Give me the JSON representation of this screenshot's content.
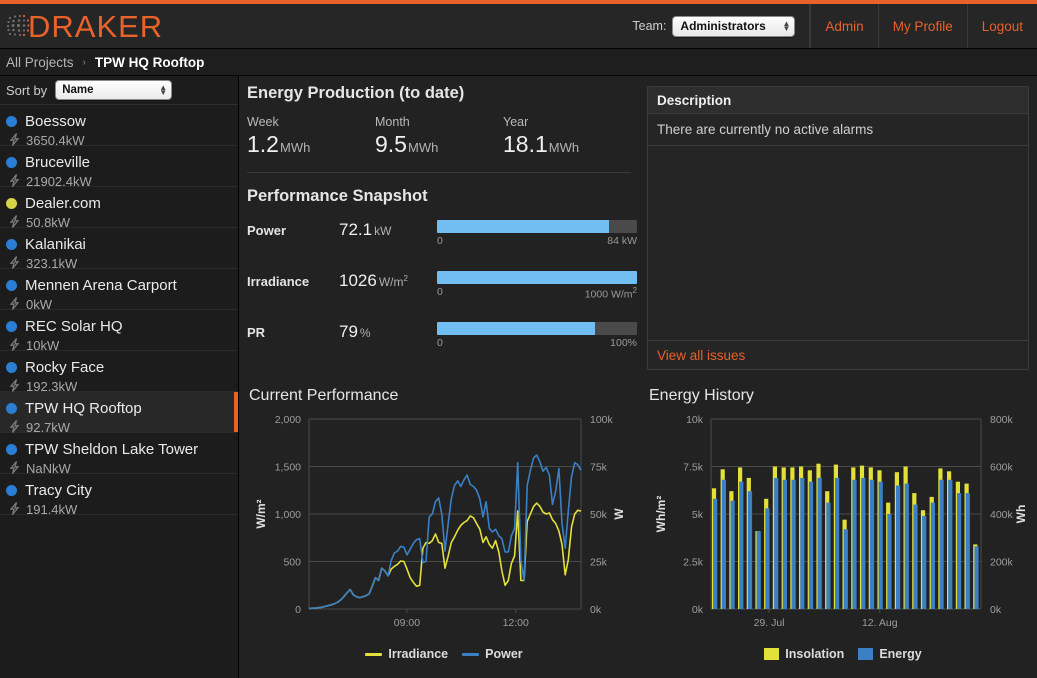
{
  "header": {
    "logo_text": "DRAKER",
    "logo_icon": "dot-matrix-icon",
    "team_label": "Team:",
    "team_value": "Administrators",
    "team_options": [
      "Administrators"
    ],
    "links": [
      {
        "label": "Admin"
      },
      {
        "label": "My Profile"
      },
      {
        "label": "Logout"
      }
    ],
    "accent_color": "#e8622a"
  },
  "breadcrumb": {
    "root": "All Projects",
    "separator": "›",
    "current": "TPW HQ Rooftop"
  },
  "sidebar": {
    "sort_label": "Sort by",
    "sort_value": "Name",
    "sort_options": [
      "Name"
    ],
    "status_colors": {
      "ok": "#2a7fd4",
      "warn": "#d8d44a"
    },
    "sites": [
      {
        "name": "Boessow",
        "power": "3650.4kW",
        "status": "ok",
        "selected": false
      },
      {
        "name": "Bruceville",
        "power": "21902.4kW",
        "status": "ok",
        "selected": false
      },
      {
        "name": "Dealer.com",
        "power": "50.8kW",
        "status": "warn",
        "selected": false
      },
      {
        "name": "Kalanikai",
        "power": "323.1kW",
        "status": "ok",
        "selected": false
      },
      {
        "name": "Mennen Arena Carport",
        "power": "0kW",
        "status": "ok",
        "selected": false
      },
      {
        "name": "REC Solar HQ",
        "power": "10kW",
        "status": "ok",
        "selected": false
      },
      {
        "name": "Rocky Face",
        "power": "192.3kW",
        "status": "ok",
        "selected": false
      },
      {
        "name": "TPW HQ Rooftop",
        "power": "92.7kW",
        "status": "ok",
        "selected": true
      },
      {
        "name": "TPW Sheldon Lake Tower",
        "power": "NaNkW",
        "status": "ok",
        "selected": false
      },
      {
        "name": "Tracy City",
        "power": "191.4kW",
        "status": "ok",
        "selected": false
      }
    ]
  },
  "energy_production": {
    "title": "Energy Production (to date)",
    "items": [
      {
        "label": "Week",
        "value": "1.2",
        "unit": "MWh"
      },
      {
        "label": "Month",
        "value": "9.5",
        "unit": "MWh"
      },
      {
        "label": "Year",
        "value": "18.1",
        "unit": "MWh"
      }
    ]
  },
  "performance_snapshot": {
    "title": "Performance Snapshot",
    "rows": [
      {
        "name": "Power",
        "value": "72.1",
        "unit": "kW",
        "min": "0",
        "max": "84 kW",
        "percent": 86
      },
      {
        "name": "Irradiance",
        "value": "1026",
        "unit": "W/m²",
        "min": "0",
        "max": "1000 W/m²",
        "percent": 100
      },
      {
        "name": "PR",
        "value": "79",
        "unit": "%",
        "min": "0",
        "max": "100%",
        "percent": 79
      }
    ]
  },
  "description_panel": {
    "title": "Description",
    "message": "There are currently no active alarms",
    "footer_link": "View all issues"
  },
  "chart_data": [
    {
      "type": "line",
      "title": "Current Performance",
      "ylabel": "W/m²",
      "ylabel_right": "W",
      "ylim": [
        0,
        2000
      ],
      "ylim_right": [
        0,
        100000
      ],
      "yticks": [
        "0",
        "500",
        "1,000",
        "1,500",
        "2,000"
      ],
      "yticks_right": [
        "0k",
        "25k",
        "50k",
        "75k",
        "100k"
      ],
      "xticks": [
        "09:00",
        "12:00"
      ],
      "xtick_positions": [
        0.36,
        0.76
      ],
      "grid": true,
      "legend_position": "bottom",
      "series": [
        {
          "name": "Irradiance",
          "color": "#e3e03a",
          "unit": "W/m²",
          "values": [
            5,
            8,
            10,
            14,
            18,
            26,
            35,
            44,
            55,
            70,
            95,
            130,
            170,
            205,
            150,
            130,
            120,
            128,
            140,
            160,
            240,
            330,
            300,
            430,
            400,
            350,
            420,
            450,
            470,
            505,
            500,
            420,
            330,
            280,
            240,
            250,
            640,
            700,
            690,
            720,
            790,
            700,
            690,
            430,
            560,
            700,
            760,
            830,
            880,
            910,
            930,
            980,
            960,
            900,
            840,
            700,
            760,
            680,
            640,
            720,
            600,
            400,
            250,
            300,
            480,
            560,
            1030,
            300,
            300,
            920,
            1000,
            1080,
            1115,
            1080,
            1020,
            1000,
            1010,
            940,
            900,
            820,
            680,
            360,
            520,
            860,
            1000,
            1040,
            1030
          ]
        },
        {
          "name": "Power",
          "color": "#3b7fc4",
          "unit": "W",
          "values": [
            250,
            400,
            500,
            700,
            900,
            1300,
            1750,
            2200,
            2750,
            3500,
            4750,
            6500,
            8500,
            10250,
            7500,
            6500,
            6000,
            6400,
            7000,
            8000,
            12000,
            16500,
            15000,
            21500,
            20000,
            17500,
            25500,
            29500,
            30500,
            33000,
            32500,
            28500,
            31500,
            34500,
            36500,
            37000,
            24500,
            25000,
            48500,
            50000,
            56500,
            58500,
            50000,
            30500,
            45000,
            58000,
            65000,
            67500,
            64500,
            68000,
            70500,
            65500,
            64500,
            62500,
            58000,
            48500,
            56500,
            42500,
            40500,
            42000,
            38500,
            37000,
            30000,
            30000,
            38500,
            42500,
            77000,
            25500,
            15000,
            65000,
            73000,
            79500,
            81000,
            77500,
            72500,
            74500,
            70500,
            55000,
            62000,
            74000,
            45000,
            32000,
            51500,
            69500,
            77000,
            76000,
            73000
          ]
        }
      ]
    },
    {
      "type": "bar",
      "title": "Energy History",
      "ylabel": "Wh/m²",
      "ylabel_right": "Wh",
      "ylim": [
        0,
        10000
      ],
      "ylim_right": [
        0,
        800000
      ],
      "yticks": [
        "0k",
        "2.5k",
        "5k",
        "7.5k",
        "10k"
      ],
      "yticks_right": [
        "0k",
        "200k",
        "400k",
        "600k",
        "800k"
      ],
      "xticks": [
        "29. Jul",
        "12. Aug"
      ],
      "xtick_positions": [
        0.215,
        0.625
      ],
      "grid": true,
      "legend_position": "bottom",
      "series": [
        {
          "name": "Insolation",
          "color": "#e3e03a",
          "unit": "Wh/m²",
          "values": [
            6350,
            7350,
            6200,
            7450,
            6900,
            4100,
            5800,
            7500,
            7450,
            7450,
            7500,
            7300,
            7650,
            6200,
            7600,
            4700,
            7450,
            7550,
            7450,
            7300,
            5600,
            7200,
            7500,
            6100,
            5200,
            5900,
            7400,
            7250,
            6700,
            6600,
            3400
          ]
        },
        {
          "name": "Energy",
          "color": "#3b7fc4",
          "unit": "Wh",
          "values": [
            464000,
            544000,
            456000,
            536000,
            496000,
            328000,
            424000,
            552000,
            544000,
            544000,
            552000,
            536000,
            552000,
            448000,
            552000,
            336000,
            544000,
            552000,
            544000,
            536000,
            400000,
            520000,
            528000,
            440000,
            392000,
            448000,
            544000,
            544000,
            488000,
            488000,
            264000
          ]
        }
      ]
    }
  ]
}
